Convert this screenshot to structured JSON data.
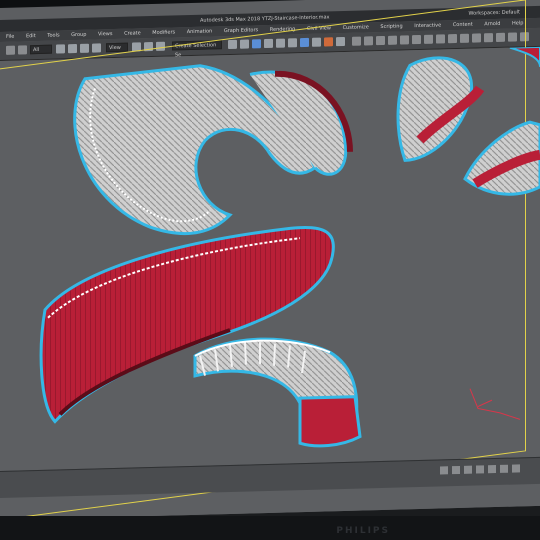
{
  "app": {
    "title": "Autodesk 3ds Max 2018    YTZJ-Staircase-Interior.max",
    "workspace_label": "Workspaces: Default"
  },
  "menu": {
    "items": [
      "File",
      "Edit",
      "Tools",
      "Group",
      "Views",
      "Create",
      "Modifiers",
      "Animation",
      "Graph Editors",
      "Rendering",
      "Civil View",
      "Customize",
      "Scripting",
      "Interactive",
      "Content",
      "Arnold",
      "Help"
    ]
  },
  "toolbar": {
    "selection_filter": "All",
    "view_dropdown": "View",
    "named_selection": "Create Selection Se"
  },
  "viewport": {
    "frame_color": "#e2d24a",
    "stair_color": "#c0223a",
    "outline_color": "#35b8e6"
  },
  "monitor": {
    "brand": "PHILIPS"
  }
}
